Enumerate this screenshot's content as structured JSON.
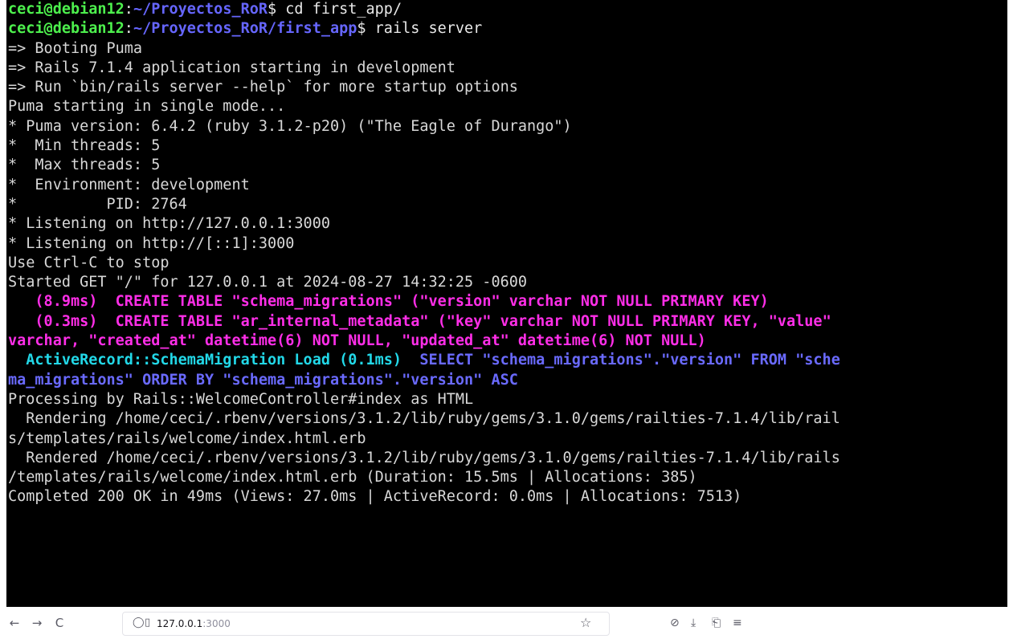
{
  "terminal": {
    "prompt1": {
      "user": "ceci@debian12",
      "path": "~/Proyectos_RoR",
      "symbol": "$",
      "command": " cd first_app/"
    },
    "prompt2": {
      "user": "ceci@debian12",
      "path": "~/Proyectos_RoR/first_app",
      "symbol": "$",
      "command": " rails server"
    },
    "boot_lines": [
      "=> Booting Puma",
      "=> Rails 7.1.4 application starting in development",
      "=> Run `bin/rails server --help` for more startup options",
      "Puma starting in single mode...",
      "* Puma version: 6.4.2 (ruby 3.1.2-p20) (\"The Eagle of Durango\")",
      "*  Min threads: 5",
      "*  Max threads: 5",
      "*  Environment: development",
      "*          PID: 2764",
      "* Listening on http://127.0.0.1:3000",
      "* Listening on http://[::1]:3000",
      "Use Ctrl-C to stop",
      "Started GET \"/\" for 127.0.0.1 at 2024-08-27 14:32:25 -0600"
    ],
    "sql1": {
      "timing": "   (8.9ms)",
      "query": "  CREATE TABLE \"schema_migrations\" (\"version\" varchar NOT NULL PRIMARY KEY)"
    },
    "sql2": {
      "timing": "   (0.3ms)",
      "query": "  CREATE TABLE \"ar_internal_metadata\" (\"key\" varchar NOT NULL PRIMARY KEY, \"value\"",
      "continuation": "varchar, \"created_at\" datetime(6) NOT NULL, \"updated_at\" datetime(6) NOT NULL)"
    },
    "load": {
      "label": "  ActiveRecord::SchemaMigration Load (0.1ms)",
      "query": "  SELECT \"schema_migrations\".\"version\" FROM \"sche",
      "continuation": "ma_migrations\" ORDER BY \"schema_migrations\".\"version\" ASC"
    },
    "tail_lines": [
      "Processing by Rails::WelcomeController#index as HTML",
      "  Rendering /home/ceci/.rbenv/versions/3.1.2/lib/ruby/gems/3.1.0/gems/railties-7.1.4/lib/rail",
      "s/templates/rails/welcome/index.html.erb",
      "  Rendered /home/ceci/.rbenv/versions/3.1.2/lib/ruby/gems/3.1.0/gems/railties-7.1.4/lib/rails",
      "/templates/rails/welcome/index.html.erb (Duration: 15.5ms | Allocations: 385)",
      "Completed 200 OK in 49ms (Views: 27.0ms | ActiveRecord: 0.0ms | Allocations: 7513)"
    ]
  },
  "browser": {
    "back_icon": "←",
    "forward_icon": "→",
    "reload_icon": "C",
    "tracking_icon": "◯",
    "page_icon": "▯",
    "url_host": "127.0.0.1",
    "url_port": ":3000",
    "bookmark_icon": "☆",
    "pocket_icon": "⊘",
    "download_icon": "⤓",
    "extensions_icon": "⎗",
    "menu_icon": "≡"
  }
}
